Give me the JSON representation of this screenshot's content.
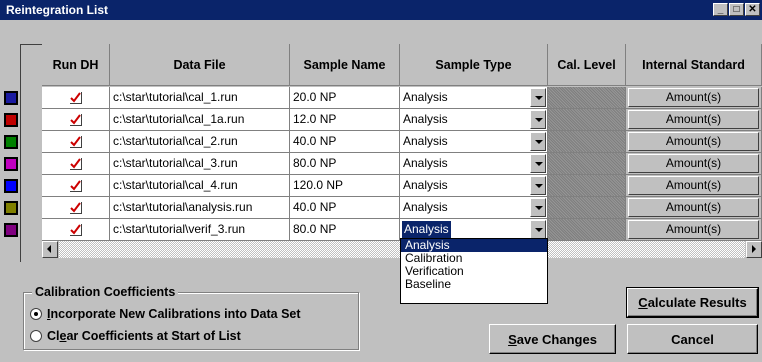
{
  "window": {
    "title": "Reintegration List",
    "controls": [
      "minimize",
      "maximize",
      "close"
    ]
  },
  "table": {
    "columns": [
      "Run DH",
      "Data File",
      "Sample Name",
      "Sample Type",
      "Cal. Level",
      "Internal Standard"
    ],
    "rows": [
      {
        "color": "#1a1aa0",
        "run": true,
        "file": "c:\\star\\tutorial\\cal_1.run",
        "sample": "20.0 NP",
        "type": "Analysis",
        "amount": "Amount(s)"
      },
      {
        "color": "#c00000",
        "run": true,
        "file": "c:\\star\\tutorial\\cal_1a.run",
        "sample": "12.0 NP",
        "type": "Analysis",
        "amount": "Amount(s)"
      },
      {
        "color": "#008000",
        "run": true,
        "file": "c:\\star\\tutorial\\cal_2.run",
        "sample": "40.0 NP",
        "type": "Analysis",
        "amount": "Amount(s)"
      },
      {
        "color": "#c000c0",
        "run": true,
        "file": "c:\\star\\tutorial\\cal_3.run",
        "sample": "80.0 NP",
        "type": "Analysis",
        "amount": "Amount(s)"
      },
      {
        "color": "#0000ff",
        "run": true,
        "file": "c:\\star\\tutorial\\cal_4.run",
        "sample": "120.0 NP",
        "type": "Analysis",
        "amount": "Amount(s)"
      },
      {
        "color": "#808000",
        "run": true,
        "file": "c:\\star\\tutorial\\analysis.run",
        "sample": "40.0 NP",
        "type": "Analysis",
        "amount": "Amount(s)"
      },
      {
        "color": "#800080",
        "run": true,
        "file": "c:\\star\\tutorial\\verif_3.run",
        "sample": "80.0 NP",
        "type": "Analysis",
        "amount": "Amount(s)"
      }
    ]
  },
  "sample_type_dropdown": {
    "options": [
      "Analysis",
      "Calibration",
      "Verification",
      "Baseline"
    ],
    "selected": "Analysis"
  },
  "calibration": {
    "title": "Calibration Coefficients",
    "options": [
      {
        "pre": "",
        "key": "I",
        "post": "ncorporate New Calibrations into Data Set",
        "selected": true
      },
      {
        "pre": "Cl",
        "key": "e",
        "post": "ar Coefficients at Start of List",
        "selected": false
      }
    ]
  },
  "buttons": {
    "calculate": {
      "key": "C",
      "rest": "alculate Results"
    },
    "save": {
      "key": "S",
      "rest": "ave Changes"
    },
    "cancel": {
      "label": "Cancel"
    }
  }
}
